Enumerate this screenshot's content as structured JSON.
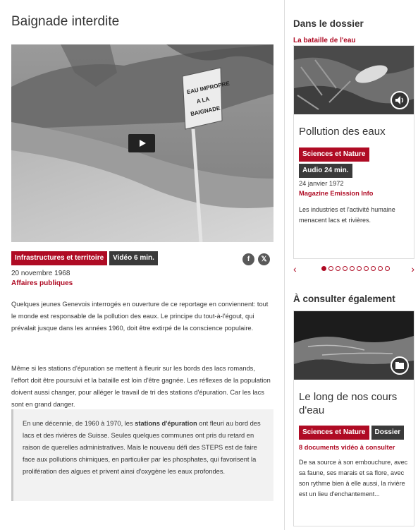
{
  "article": {
    "title": "Baignade interdite",
    "tags": [
      {
        "label": "Infrastructures et territoire",
        "style": "red"
      },
      {
        "label": "Vidéo 6 min.",
        "style": "dark"
      }
    ],
    "date": "20 novembre 1968",
    "program": "Affaires publiques",
    "paragraphs": [
      "Quelques jeunes Genevois interrogés en ouverture de ce reportage en conviennent: tout le monde est responsable de la pollution des eaux. Le principe du tout-à-l'égout, qui prévalait jusque dans les années 1960, doit être extirpé de la conscience populaire.",
      "Même si les stations d'épuration se mettent à fleurir sur les bords des lacs romands, l'effort doit être poursuivi et la bataille est loin d'être gagnée. Les réflexes de la population doivent aussi changer, pour alléger le travail de tri des stations d'épuration. Car les lacs sont en grand danger."
    ],
    "quote": {
      "before": "En une décennie, de 1960 à 1970, les ",
      "bold": "stations d'épuration",
      "after": " ont fleuri au bord des lacs et des rivières de Suisse. Seules quelques communes ont pris du retard en raison de querelles administratives. Mais le nouveau défi des STEPS est de faire face aux pollutions chimiques, en particulier par les phosphates, qui favorisent la prolifération des algues et privent ainsi d'oxygène les eaux profondes."
    },
    "video_sign_text": [
      "EAU IMPROPRE",
      "A LA",
      "BAIGNADE"
    ],
    "share": {
      "facebook_glyph": "f",
      "x_glyph": "𝕏"
    }
  },
  "sidebar": {
    "dossier_heading": "Dans le dossier",
    "dossier_link": "La bataille de l'eau",
    "card1": {
      "title": "Pollution des eaux",
      "tags": [
        {
          "label": "Sciences et Nature",
          "style": "red"
        },
        {
          "label": "Audio 24 min.",
          "style": "dark"
        }
      ],
      "date": "24 janvier 1972",
      "program": "Magazine Emission Info",
      "description": "Les industries et l'activité humaine menacent lacs et rivières.",
      "media_icon": "speaker-icon"
    },
    "carousel": {
      "dot_count": 10,
      "active_index": 0
    },
    "also_heading": "À consulter également",
    "card2": {
      "title": "Le long de nos cours d'eau",
      "tags": [
        {
          "label": "Sciences et Nature",
          "style": "red"
        },
        {
          "label": "Dossier",
          "style": "dark"
        }
      ],
      "program": "8 documents vidéo à consulter",
      "description": "De sa source à son embouchure, avec sa faune, ses marais et sa flore, avec son rythme bien à elle aussi, la rivière est un lieu d'enchantement...",
      "media_icon": "folder-icon"
    }
  },
  "colors": {
    "accent": "#af0b24",
    "dark_tag": "#3a3a3a"
  }
}
